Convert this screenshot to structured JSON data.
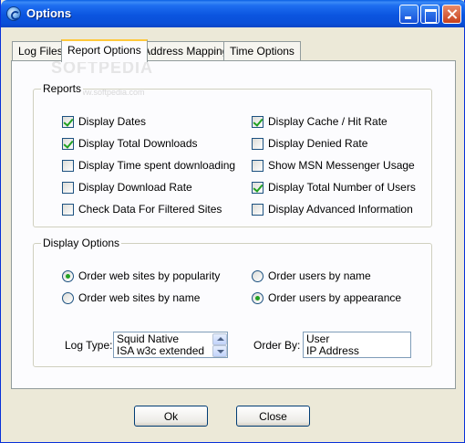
{
  "window": {
    "title": "Options"
  },
  "tabs": [
    {
      "label": "Log Files"
    },
    {
      "label": "Report Options"
    },
    {
      "label": "Address Mapping"
    },
    {
      "label": "Time Options"
    }
  ],
  "watermark": {
    "text": "SOFTPEDIA",
    "sub": "www.softpedia.com"
  },
  "reports": {
    "legend": "Reports",
    "left": [
      {
        "label": "Display Dates",
        "checked": true
      },
      {
        "label": "Display Total Downloads",
        "checked": true
      },
      {
        "label": "Display Time spent downloading",
        "checked": false
      },
      {
        "label": "Display Download Rate",
        "checked": false
      },
      {
        "label": "Check Data For Filtered Sites",
        "checked": false
      }
    ],
    "right": [
      {
        "label": "Display Cache / Hit Rate",
        "checked": true
      },
      {
        "label": "Display Denied Rate",
        "checked": false
      },
      {
        "label": "Show MSN Messenger Usage",
        "checked": false
      },
      {
        "label": "Display Total Number of Users",
        "checked": true
      },
      {
        "label": "Display Advanced Information",
        "checked": false
      }
    ]
  },
  "display_options": {
    "legend": "Display Options",
    "sites_popularity": "Order web sites by popularity",
    "sites_name": "Order web sites by name",
    "users_name": "Order users by name",
    "users_appearance": "Order users by appearance",
    "log_type_label": "Log Type:",
    "log_types": [
      "Squid Native",
      "ISA w3c extended"
    ],
    "order_by_label": "Order By:",
    "order_by": [
      "User",
      "IP Address"
    ]
  },
  "buttons": {
    "ok": "Ok",
    "close": "Close"
  }
}
